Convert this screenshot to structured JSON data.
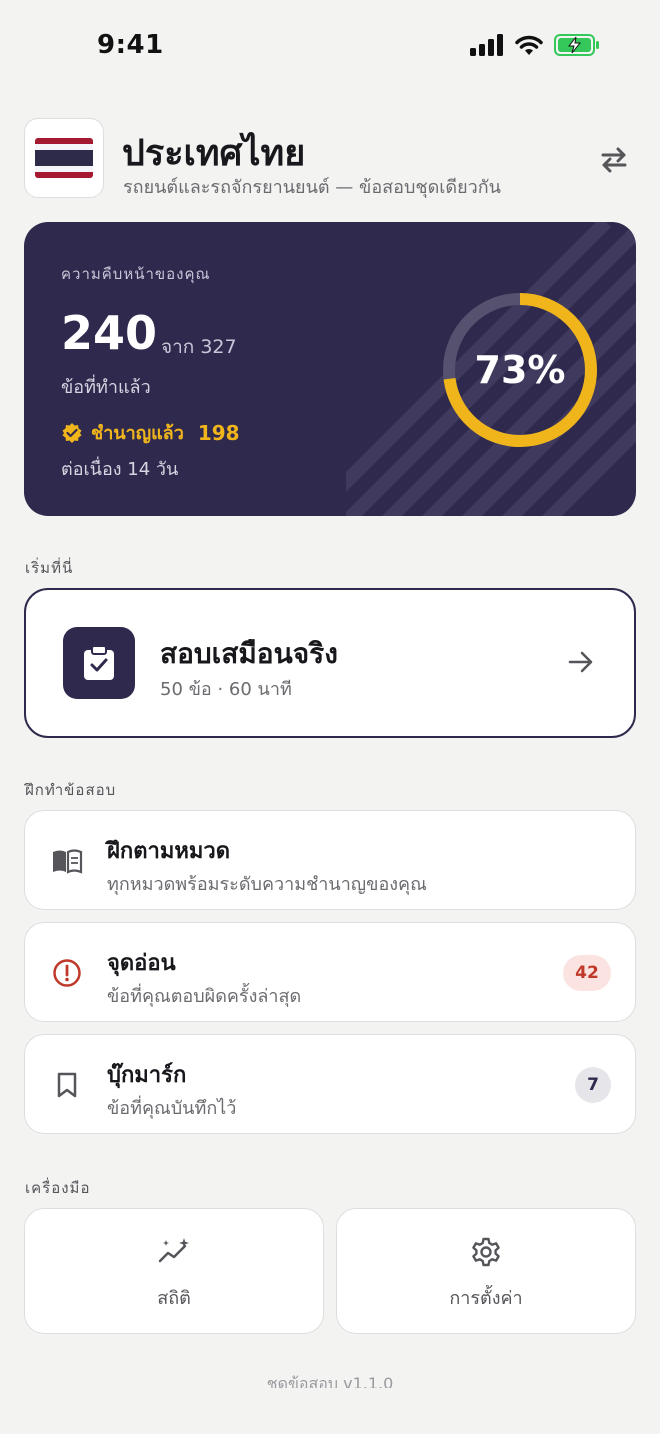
{
  "status_bar": {
    "time": "9:41"
  },
  "header": {
    "title": "ประเทศไทย",
    "subtitle": "รถยนต์และรถจักรยานยนต์ — ข้อสอบชุดเดียวกัน"
  },
  "progress": {
    "label": "ความคืบหน้าของคุณ",
    "done": "240",
    "total_text": "จาก 327",
    "done_label": "ข้อที่ทำแล้ว",
    "mastered_label": "ชำนาญแล้ว",
    "mastered_count": "198",
    "streak": "ต่อเนื่อง 14 วัน",
    "percent_text": "73%",
    "percent": 73,
    "ring_color": "#f1b51c"
  },
  "start_section": {
    "label": "เริ่มที่นี่"
  },
  "mock_exam": {
    "title": "สอบเสมือนจริง",
    "subtitle": "50 ข้อ · 60 นาที"
  },
  "practice_section": {
    "label": "ฝึกทำข้อสอบ",
    "items": [
      {
        "title": "ฝึกตามหมวด",
        "subtitle": "ทุกหมวดพร้อมระดับความชำนาญของคุณ",
        "icon": "book-icon"
      },
      {
        "title": "จุดอ่อน",
        "subtitle": "ข้อที่คุณตอบผิดครั้งล่าสุด",
        "icon": "alert-circle-icon",
        "badge": "42"
      },
      {
        "title": "บุ๊กมาร์ก",
        "subtitle": "ข้อที่คุณบันทึกไว้",
        "icon": "bookmark-icon",
        "badge": "7"
      }
    ]
  },
  "tools_section": {
    "label": "เครื่องมือ",
    "items": [
      {
        "label": "สถิติ",
        "icon": "stats-sparkle-icon"
      },
      {
        "label": "การตั้งค่า",
        "icon": "gear-icon"
      }
    ]
  },
  "footer": {
    "version": "ชุดข้อสอบ v1.1.0"
  },
  "colors": {
    "brand_dark": "#2f2a4d",
    "accent_gold": "#f1b51c",
    "danger": "#c0392b",
    "battery_green": "#34c759"
  }
}
